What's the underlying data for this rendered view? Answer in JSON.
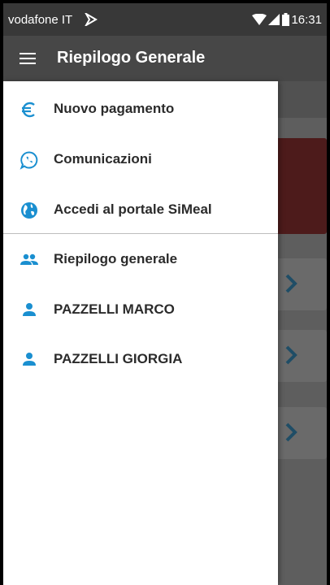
{
  "status_bar": {
    "carrier": "vodafone IT",
    "time": "16:31"
  },
  "app_bar": {
    "title": "Riepilogo Generale",
    "menu_icon": "hamburger-menu-icon"
  },
  "drawer": {
    "accent_color": "#1a8fd0",
    "sections": [
      {
        "items": [
          {
            "label": "Nuovo pagamento",
            "icon": "euro-icon"
          },
          {
            "label": "Comunicazioni",
            "icon": "whatsapp-icon"
          },
          {
            "label": "Accedi al portale SiMeal",
            "icon": "globe-icon"
          }
        ]
      },
      {
        "items": [
          {
            "label": "Riepilogo generale",
            "icon": "people-icon"
          },
          {
            "label": "PAZZELLI MARCO",
            "icon": "person-icon"
          },
          {
            "label": "PAZZELLI GIORGIA",
            "icon": "person-icon"
          }
        ]
      }
    ]
  },
  "background": {
    "alert_color": "#4d1b1b",
    "chevron_icon": "chevron-right-icon"
  }
}
